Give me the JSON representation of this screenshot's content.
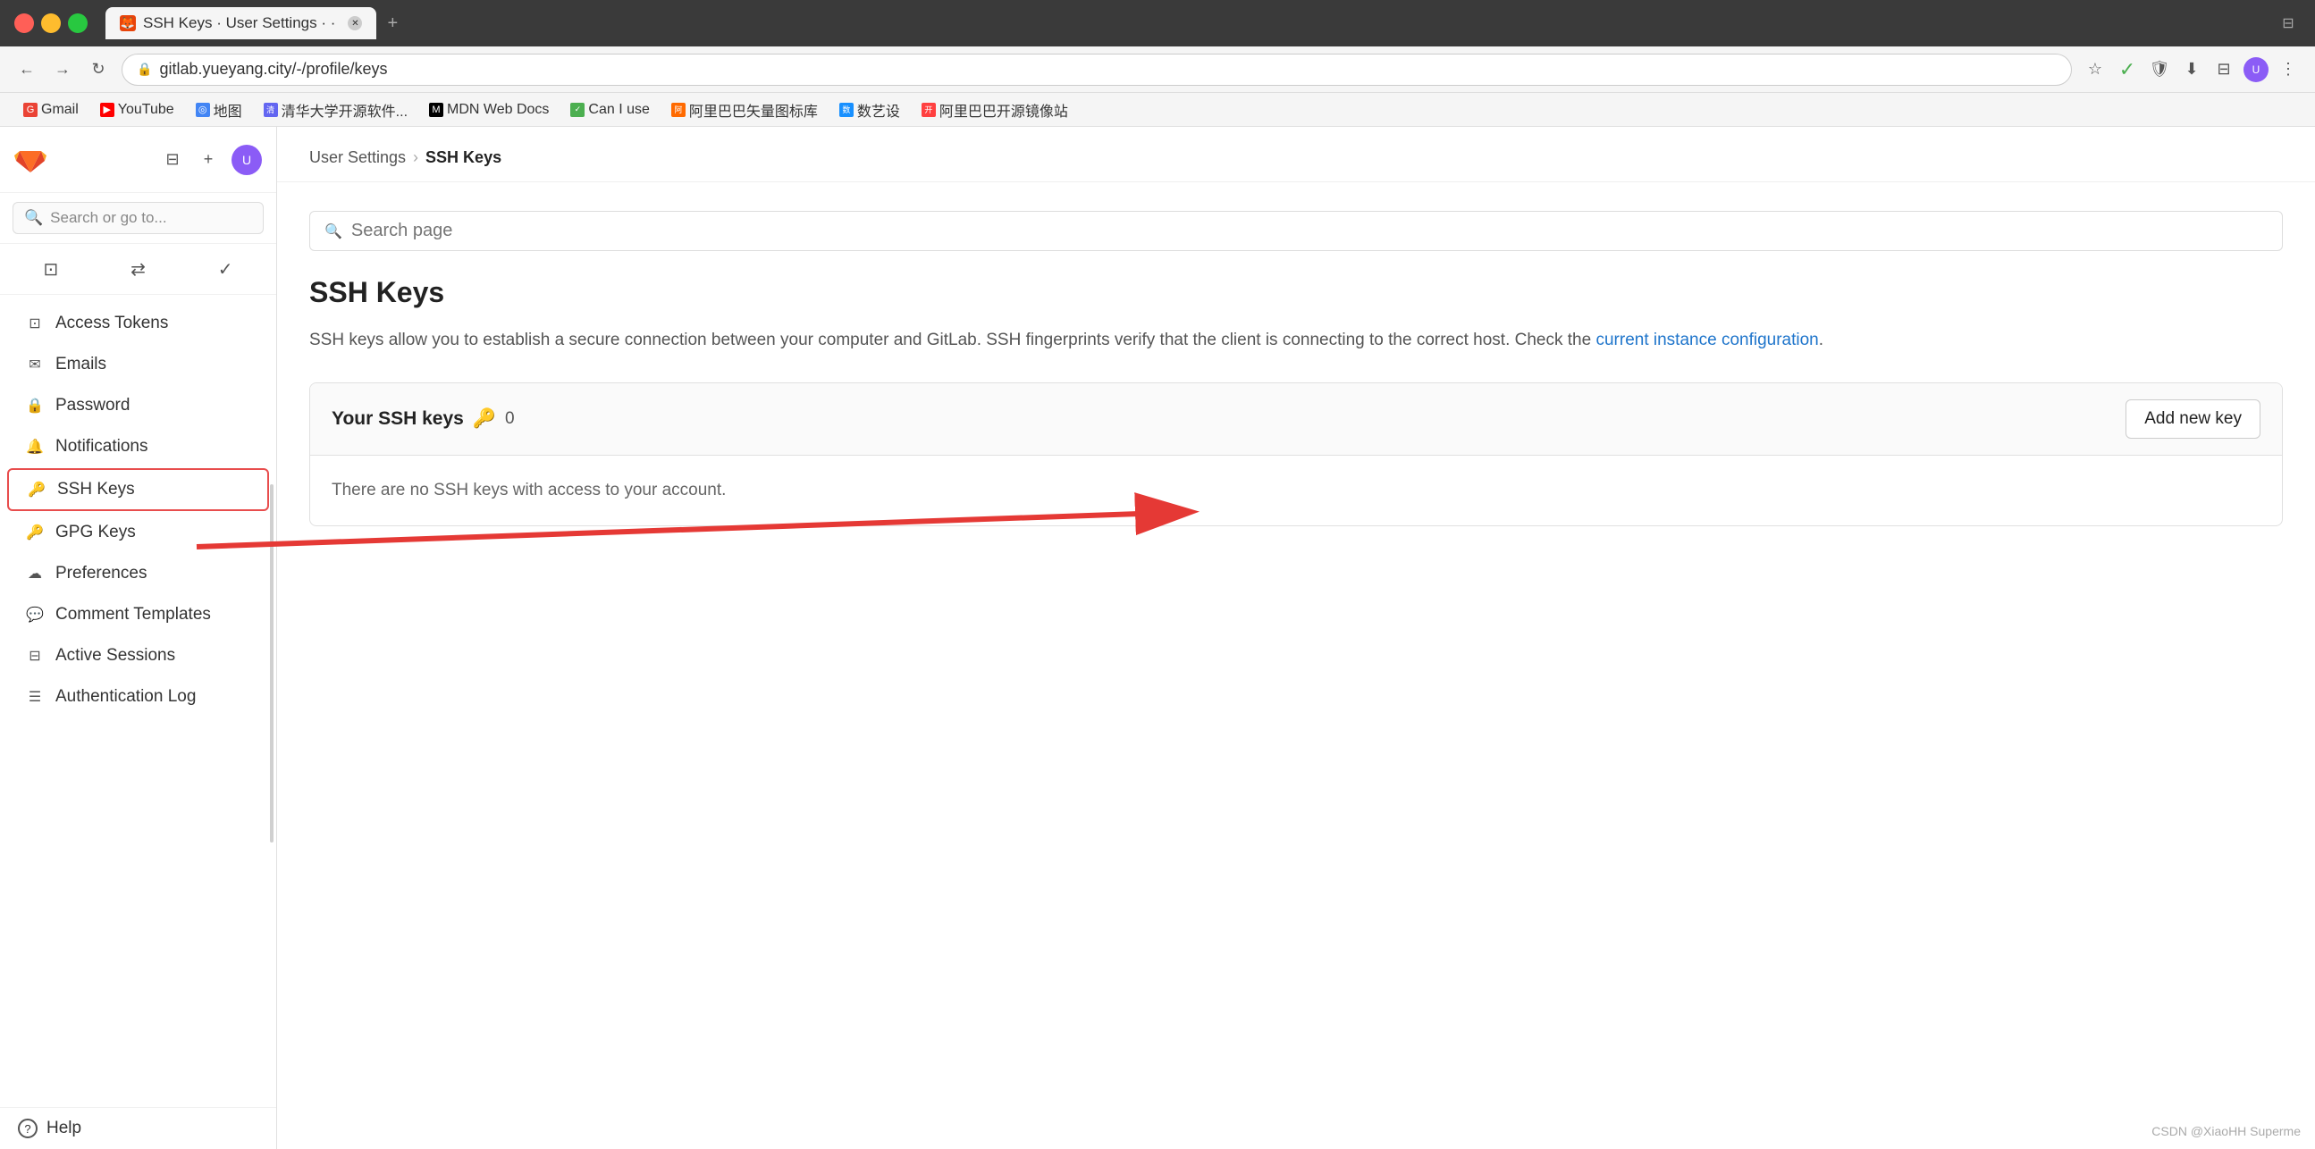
{
  "browser": {
    "title": "SSH Keys · User Settings · GitLab",
    "tab_label": "SSH Keys · User Settings · ·",
    "url": "gitlab.yueyang.city/-/profile/keys",
    "nav_back": "←",
    "nav_forward": "→",
    "nav_refresh": "↻"
  },
  "bookmarks": [
    {
      "id": "gmail",
      "icon": "G",
      "label": "Gmail",
      "color": "#ea4335"
    },
    {
      "id": "youtube",
      "icon": "▶",
      "label": "YouTube",
      "color": "#ff0000"
    },
    {
      "id": "maps",
      "icon": "◎",
      "label": "地图",
      "color": "#4285f4"
    },
    {
      "id": "tsinghua",
      "icon": "清",
      "label": "清华大学开源软件...",
      "color": "#6366f1"
    },
    {
      "id": "mdn",
      "icon": "M",
      "label": "MDN Web Docs",
      "color": "#1a1a1a"
    },
    {
      "id": "canuse",
      "icon": "✓",
      "label": "Can I use",
      "color": "#4caf50"
    },
    {
      "id": "alibaba-icon",
      "icon": "阿",
      "label": "阿里巴巴矢量图标库",
      "color": "#ff6a00"
    },
    {
      "id": "shejiyun",
      "icon": "数",
      "label": "数艺设",
      "color": "#1890ff"
    },
    {
      "id": "mirror",
      "icon": "开",
      "label": "阿里巴巴开源镜像站",
      "color": "#ff4040"
    }
  ],
  "sidebar": {
    "search_placeholder": "Search or go to...",
    "menu_items": [
      {
        "id": "access-tokens",
        "icon": "⊡",
        "label": "Access Tokens"
      },
      {
        "id": "emails",
        "icon": "✉",
        "label": "Emails"
      },
      {
        "id": "password",
        "icon": "🔒",
        "label": "Password"
      },
      {
        "id": "notifications",
        "icon": "🔔",
        "label": "Notifications"
      },
      {
        "id": "ssh-keys",
        "icon": "🔑",
        "label": "SSH Keys",
        "active": true
      },
      {
        "id": "gpg-keys",
        "icon": "🔑",
        "label": "GPG Keys"
      },
      {
        "id": "preferences",
        "icon": "☁",
        "label": "Preferences"
      },
      {
        "id": "comment-templates",
        "icon": "💬",
        "label": "Comment Templates"
      },
      {
        "id": "active-sessions",
        "icon": "⊟",
        "label": "Active Sessions"
      },
      {
        "id": "authentication-log",
        "icon": "☰",
        "label": "Authentication Log"
      }
    ],
    "help_label": "Help"
  },
  "breadcrumb": {
    "parent": "User Settings",
    "current": "SSH Keys",
    "separator": "›"
  },
  "page": {
    "search_placeholder": "Search page",
    "title": "SSH Keys",
    "description_part1": "SSH keys allow you to establish a secure connection between your computer and GitLab. SSH fingerprints verify that the client is connecting to the correct host. Check the ",
    "description_link": "current instance configuration",
    "description_part2": ".",
    "ssh_section": {
      "title": "Your SSH keys",
      "key_icon": "🔑",
      "count": "0",
      "empty_message": "There are no SSH keys with access to your account.",
      "add_button": "Add new key"
    }
  },
  "watermark": "CSDN @XiaoHH Superme"
}
